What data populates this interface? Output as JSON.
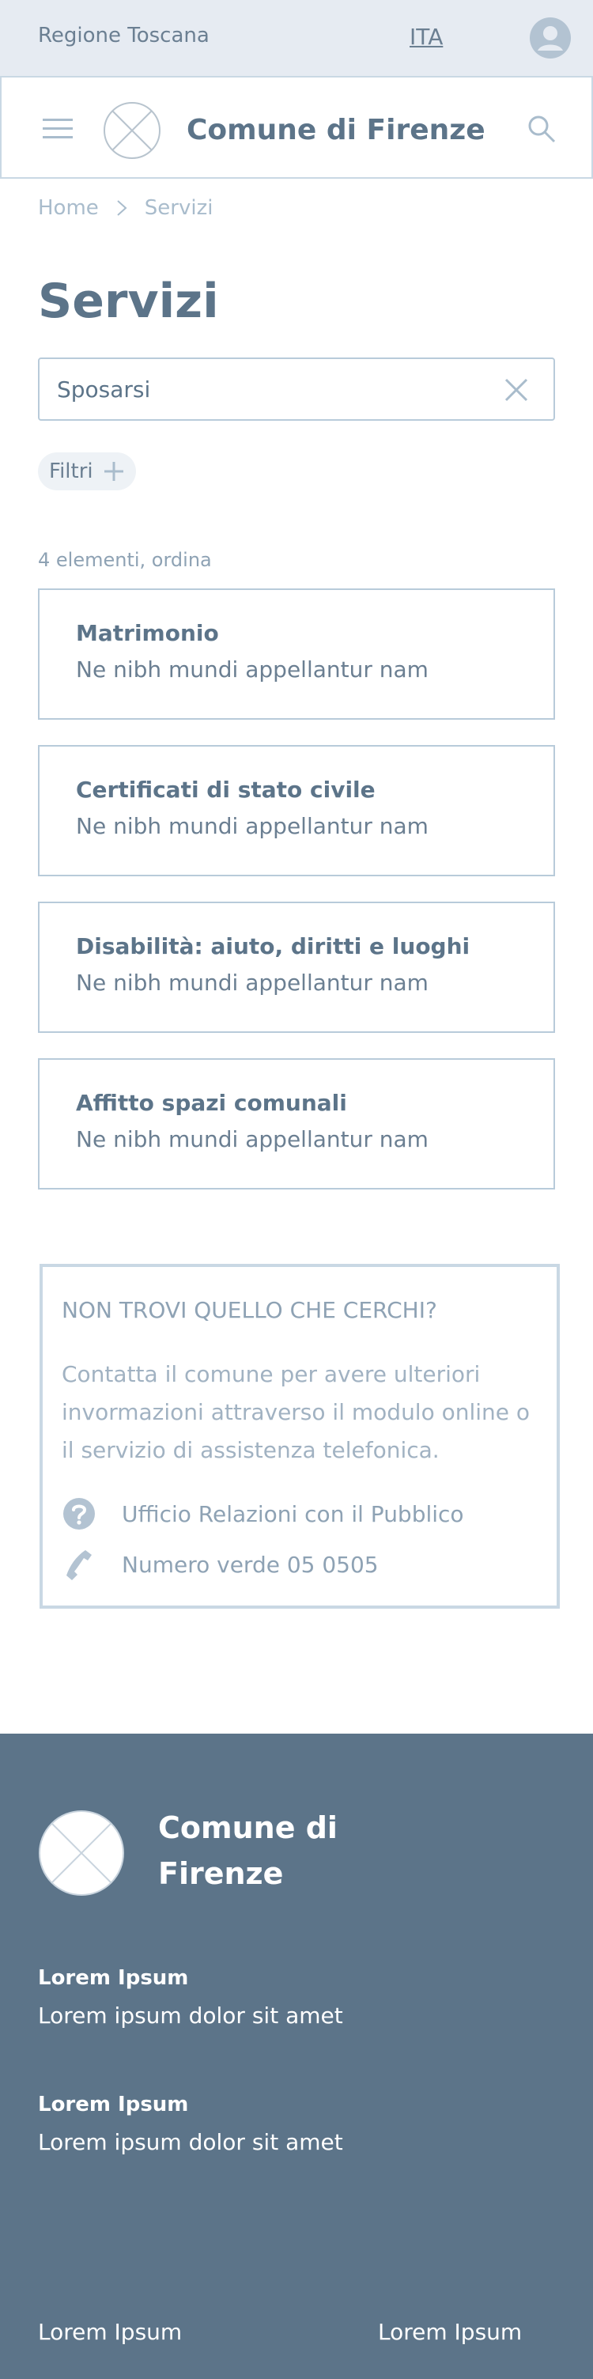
{
  "topbar": {
    "region": "Regione Toscana",
    "language": "ITA"
  },
  "header": {
    "title": "Comune di Firenze"
  },
  "breadcrumb": {
    "home": "Home",
    "current": "Servizi"
  },
  "page": {
    "title": "Servizi"
  },
  "search": {
    "value": "Sposarsi"
  },
  "filters": {
    "label": "Filtri"
  },
  "results": {
    "count_label": "4 elementi, ordina",
    "items": [
      {
        "title": "Matrimonio",
        "description": "Ne nibh mundi appellantur nam"
      },
      {
        "title": "Certificati di stato civile",
        "description": "Ne nibh mundi appellantur nam"
      },
      {
        "title": "Disabilità: aiuto, diritti e luoghi",
        "description": "Ne nibh mundi appellantur nam"
      },
      {
        "title": "Affitto spazi comunali",
        "description": "Ne nibh mundi appellantur nam"
      }
    ]
  },
  "help": {
    "title": "NON TROVI QUELLO CHE CERCHI?",
    "text": "Contatta il comune per avere ulteriori invormazioni attraverso il modulo online o il servizio di assistenza telefonica.",
    "office": "Ufficio Relazioni con il Pubblico",
    "phone": "Numero verde 05 0505"
  },
  "footer": {
    "name": "Comune di Firenze",
    "sections": [
      {
        "heading": "Lorem Ipsum",
        "text": "Lorem ipsum dolor sit amet"
      },
      {
        "heading": "Lorem Ipsum",
        "text": "Lorem ipsum dolor sit amet"
      }
    ],
    "bottom_left": "Lorem Ipsum",
    "bottom_right": "Lorem Ipsum"
  },
  "colors": {
    "topbar_bg": "#e6ebf2",
    "primary": "#5c7489",
    "border": "#b8cbda",
    "footer_bg": "#5c7489"
  }
}
